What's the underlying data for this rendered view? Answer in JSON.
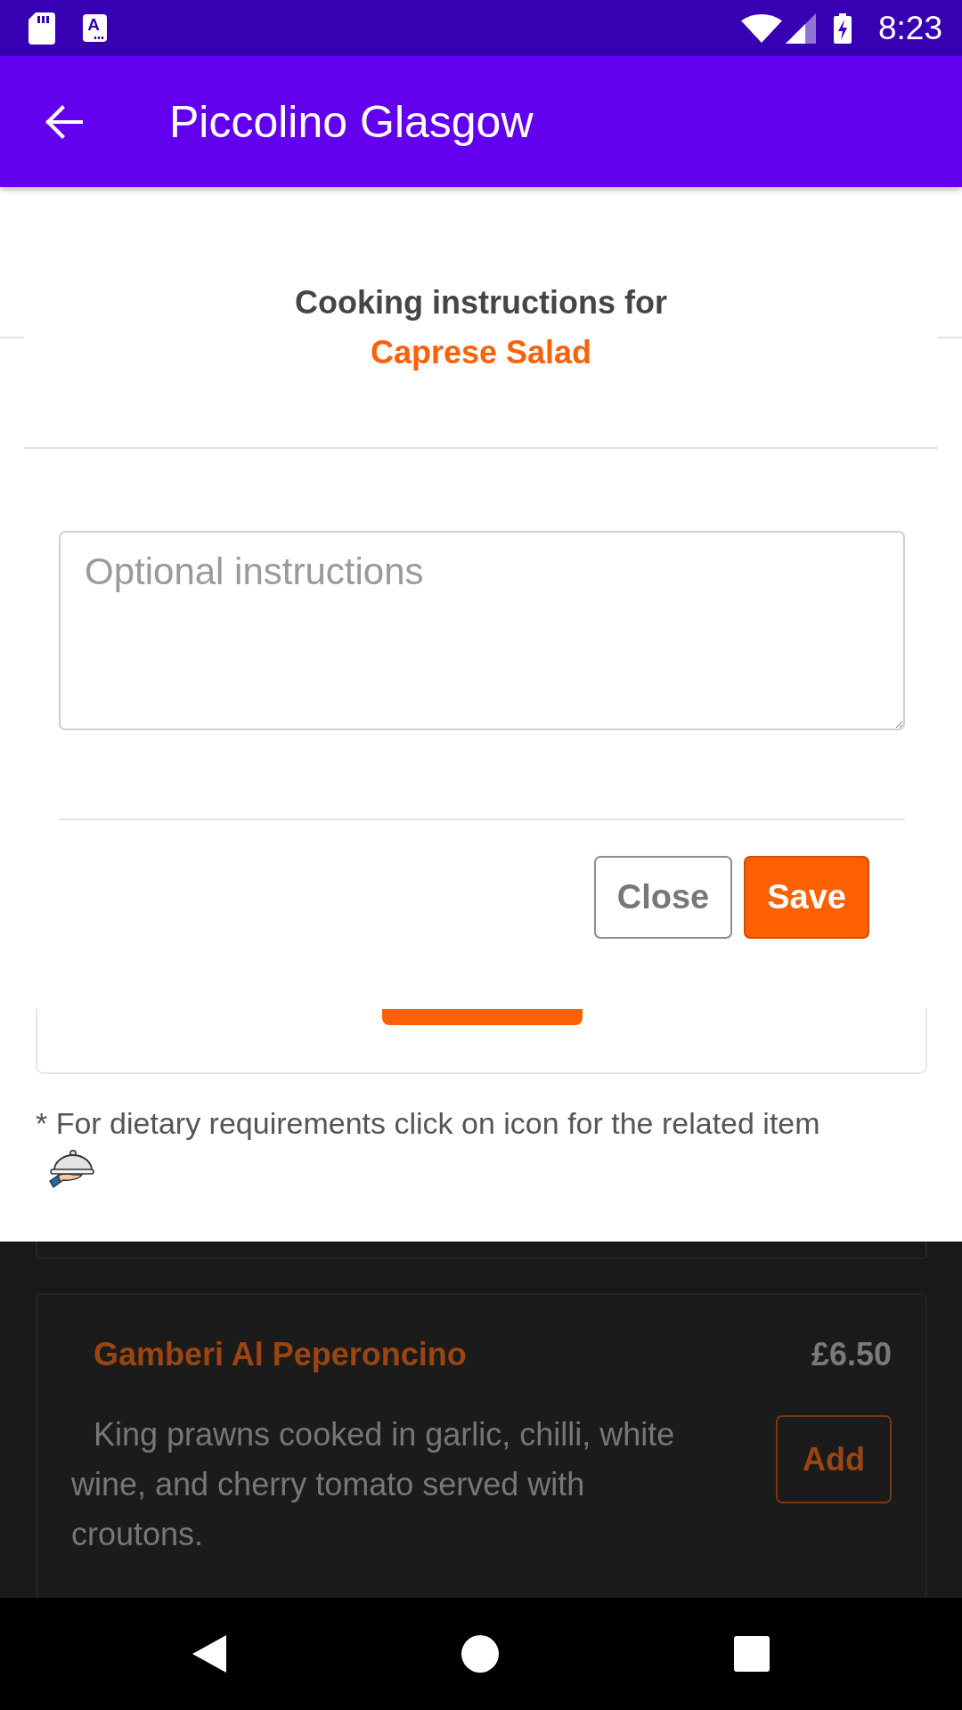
{
  "status_bar": {
    "notification_letter": "A",
    "time": "8:23"
  },
  "app_bar": {
    "title": "Piccolino Glasgow"
  },
  "dialog": {
    "title": "Cooking instructions for",
    "item_name": "Caprese Salad",
    "instructions_field": {
      "placeholder": "Optional instructions"
    },
    "buttons": [
      {
        "label": "Close",
        "kind": "secondary"
      },
      {
        "label": "Save",
        "kind": "primary"
      }
    ]
  },
  "page": {
    "note": "* For dietary requirements click on icon for the related item",
    "lower_section": {
      "dimmed": true,
      "menu_items": [
        {
          "name": "Gamberi Al Peperoncino",
          "price": "£6.50",
          "description": "King prawns cooked in garlic, chilli, white wine, and cherry tomato served with croutons.",
          "button": "Add"
        }
      ]
    }
  }
}
